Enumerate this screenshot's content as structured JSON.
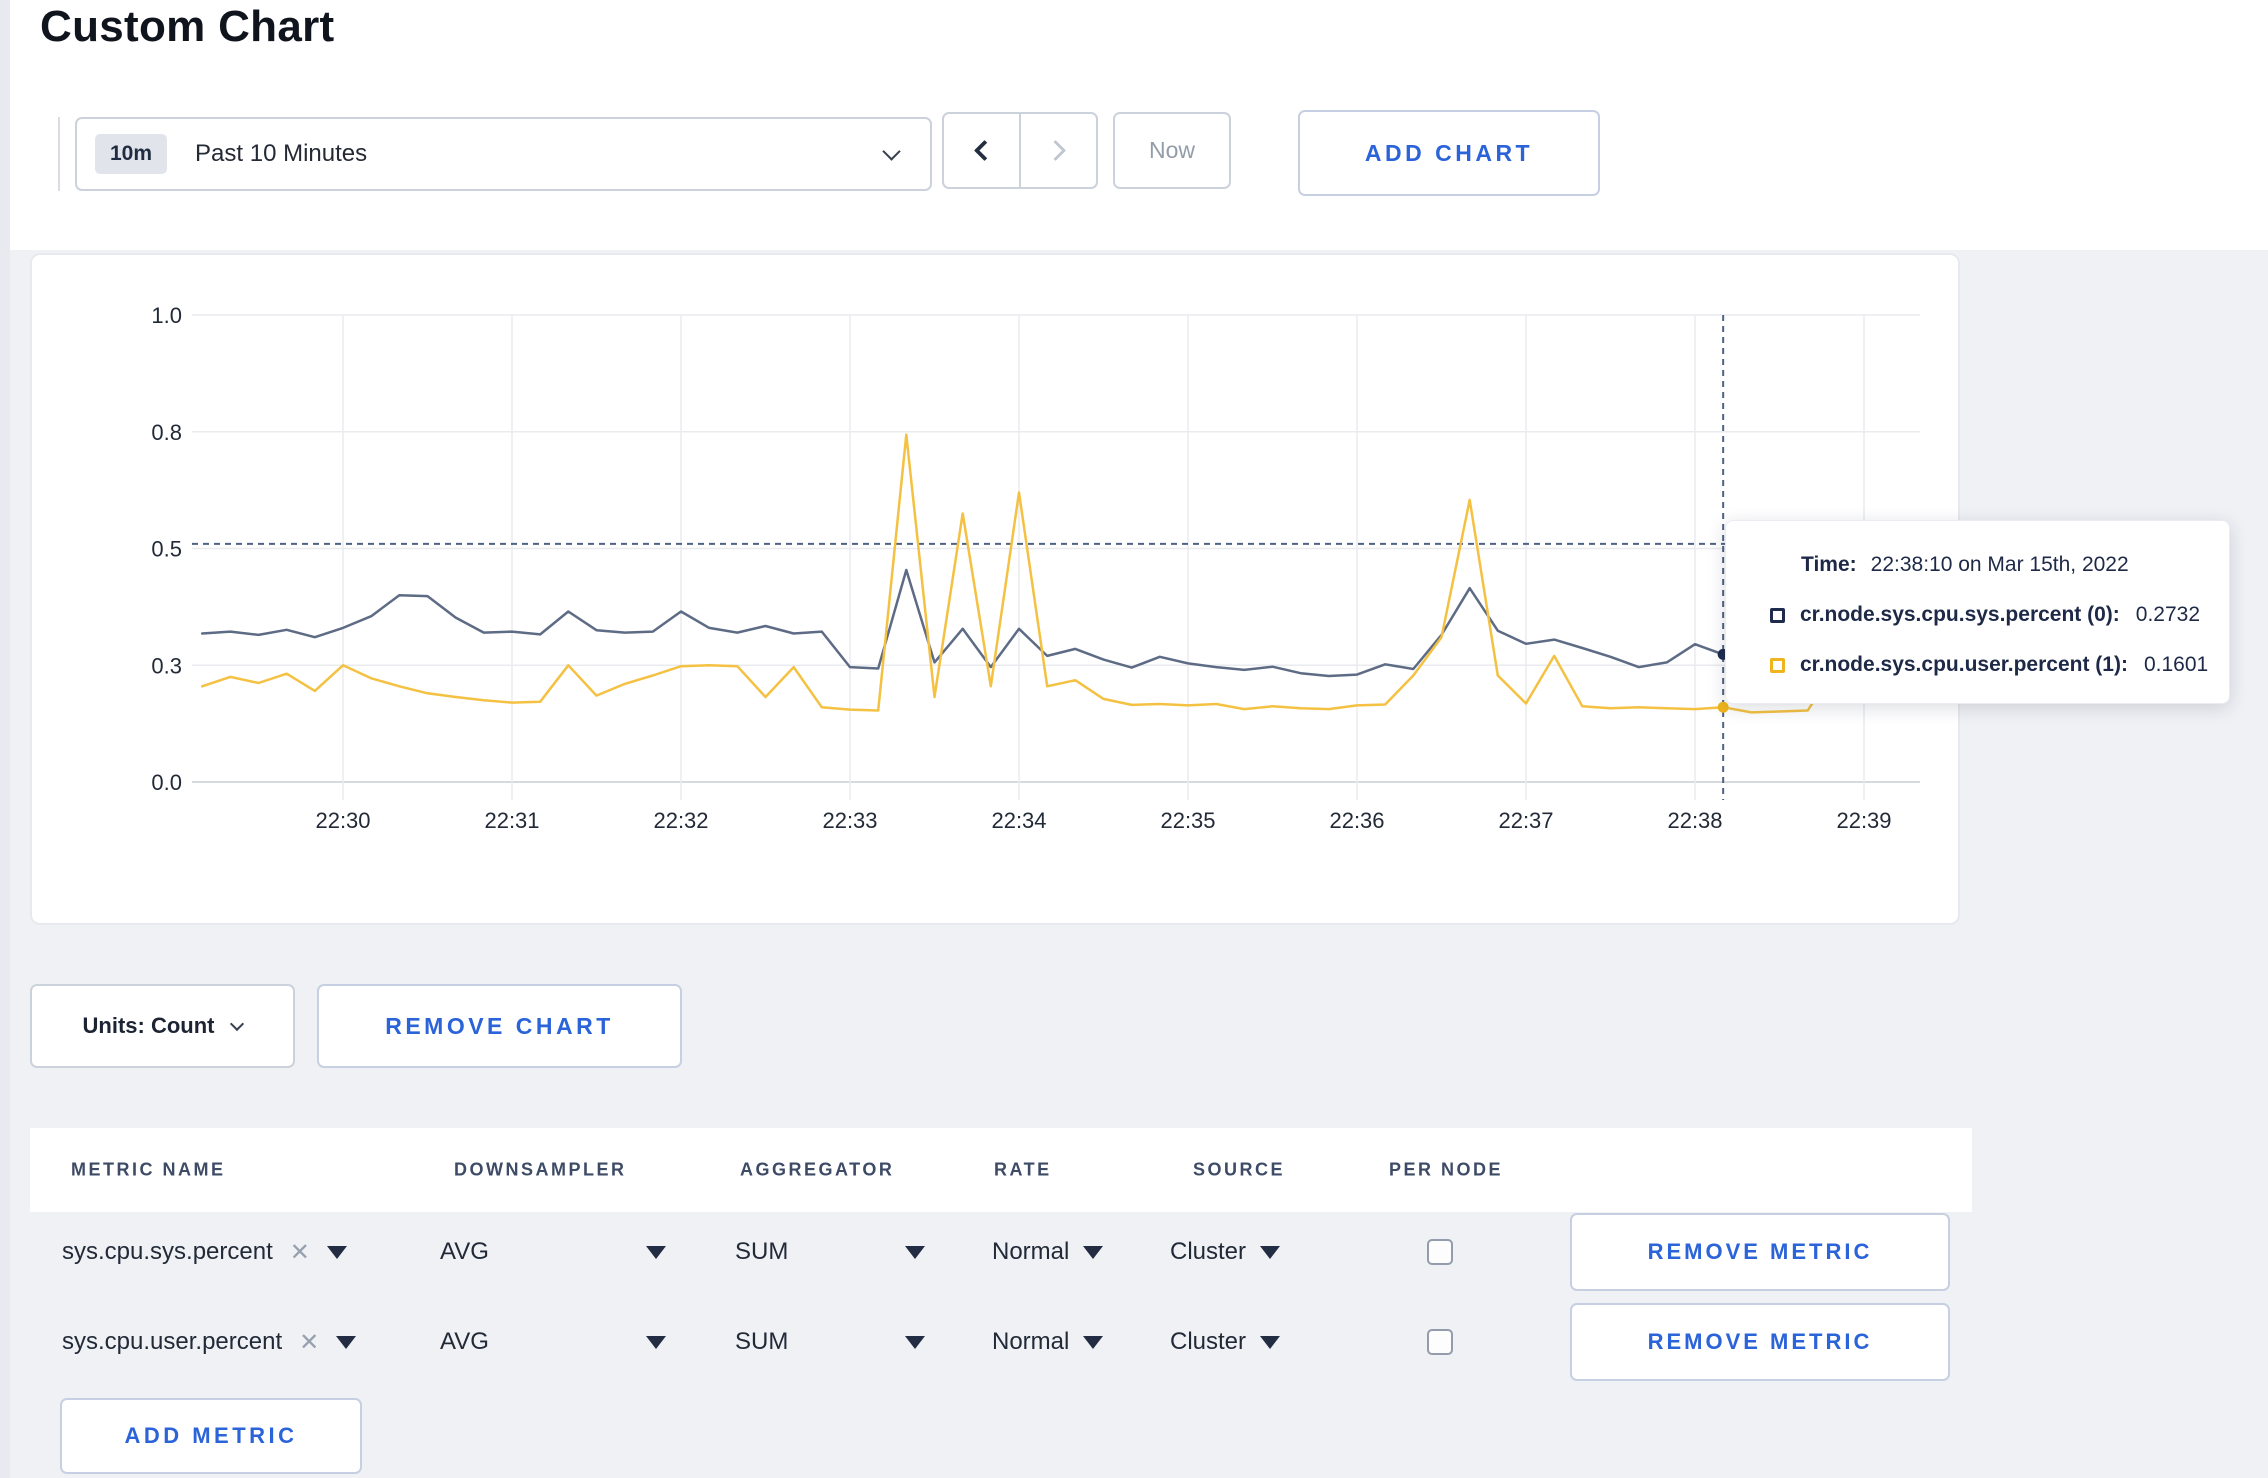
{
  "page": {
    "title": "Custom Chart"
  },
  "toolbar": {
    "range_badge": "10m",
    "range_label": "Past 10 Minutes",
    "prev_icon": "chevron-left",
    "next_icon": "chevron-right",
    "now_label": "Now",
    "add_chart_label": "ADD CHART"
  },
  "chart_data": {
    "type": "line",
    "title": "",
    "xlabel": "",
    "ylabel": "",
    "grid": true,
    "legend_position": "tooltip",
    "x_axis": {
      "ticks": [
        "22:30",
        "22:31",
        "22:32",
        "22:33",
        "22:34",
        "22:35",
        "22:36",
        "22:37",
        "22:38",
        "22:39"
      ],
      "tick_interval_s": 60
    },
    "y_axis": {
      "range": [
        0,
        1
      ],
      "ticks": [
        {
          "label": "0.0",
          "value": 0
        },
        {
          "label": "0.3",
          "value": 0.25
        },
        {
          "label": "0.5",
          "value": 0.5
        },
        {
          "label": "0.8",
          "value": 0.75
        },
        {
          "label": "1.0",
          "value": 1
        }
      ]
    },
    "start_offset_s": -50,
    "step_s": 10,
    "series": [
      {
        "name": "cr.node.sys.cpu.sys.percent (0)",
        "color": "#5e6b85",
        "values": [
          0.318,
          0.322,
          0.315,
          0.326,
          0.31,
          0.33,
          0.355,
          0.4,
          0.398,
          0.352,
          0.32,
          0.322,
          0.316,
          0.365,
          0.325,
          0.32,
          0.322,
          0.365,
          0.33,
          0.32,
          0.334,
          0.318,
          0.322,
          0.246,
          0.243,
          0.454,
          0.256,
          0.328,
          0.246,
          0.328,
          0.27,
          0.285,
          0.262,
          0.245,
          0.268,
          0.254,
          0.246,
          0.24,
          0.247,
          0.233,
          0.227,
          0.23,
          0.252,
          0.242,
          0.315,
          0.415,
          0.324,
          0.296,
          0.305,
          0.287,
          0.268,
          0.246,
          0.256,
          0.295,
          0.2732,
          0.262,
          0.277,
          0.29,
          0.302,
          0.31,
          0.3,
          0.306
        ]
      },
      {
        "name": "cr.node.sys.cpu.user.percent (1)",
        "color": "#f4c142",
        "values": [
          0.205,
          0.225,
          0.212,
          0.232,
          0.195,
          0.25,
          0.222,
          0.205,
          0.19,
          0.182,
          0.175,
          0.17,
          0.172,
          0.25,
          0.185,
          0.21,
          0.228,
          0.248,
          0.25,
          0.248,
          0.182,
          0.246,
          0.16,
          0.155,
          0.153,
          0.744,
          0.182,
          0.575,
          0.205,
          0.62,
          0.205,
          0.218,
          0.178,
          0.165,
          0.167,
          0.164,
          0.167,
          0.156,
          0.162,
          0.158,
          0.156,
          0.164,
          0.166,
          0.228,
          0.31,
          0.604,
          0.228,
          0.168,
          0.27,
          0.162,
          0.158,
          0.16,
          0.158,
          0.156,
          0.1601,
          0.149,
          0.151,
          0.153,
          0.246,
          0.192,
          0.208,
          0.196
        ]
      }
    ],
    "crosshair": {
      "time_offset_s": 490,
      "y_value": 0.51
    },
    "tooltip": {
      "time_label": "Time:",
      "time_value": "22:38:10 on Mar 15th, 2022",
      "rows": [
        {
          "name": "cr.node.sys.cpu.sys.percent (0):",
          "value": "0.2732",
          "color": "#1e2b4d"
        },
        {
          "name": "cr.node.sys.cpu.user.percent (1):",
          "value": "0.1601",
          "color": "#f0b51c"
        }
      ]
    }
  },
  "chart_controls": {
    "units_label": "Units: Count",
    "remove_chart_label": "REMOVE CHART"
  },
  "metrics_table": {
    "headers": [
      "METRIC NAME",
      "DOWNSAMPLER",
      "AGGREGATOR",
      "RATE",
      "SOURCE",
      "PER NODE"
    ],
    "rows": [
      {
        "metric": "sys.cpu.sys.percent",
        "downsampler": "AVG",
        "aggregator": "SUM",
        "rate": "Normal",
        "source": "Cluster",
        "per_node_checked": false,
        "remove_label": "REMOVE METRIC"
      },
      {
        "metric": "sys.cpu.user.percent",
        "downsampler": "AVG",
        "aggregator": "SUM",
        "rate": "Normal",
        "source": "Cluster",
        "per_node_checked": false,
        "remove_label": "REMOVE METRIC"
      }
    ],
    "add_metric_label": "ADD METRIC"
  },
  "colors": {
    "accent_blue": "#2b63d9",
    "page_background": "#eff1f5",
    "gridline": "#e9ebef",
    "crosshair": "#4e6284"
  }
}
